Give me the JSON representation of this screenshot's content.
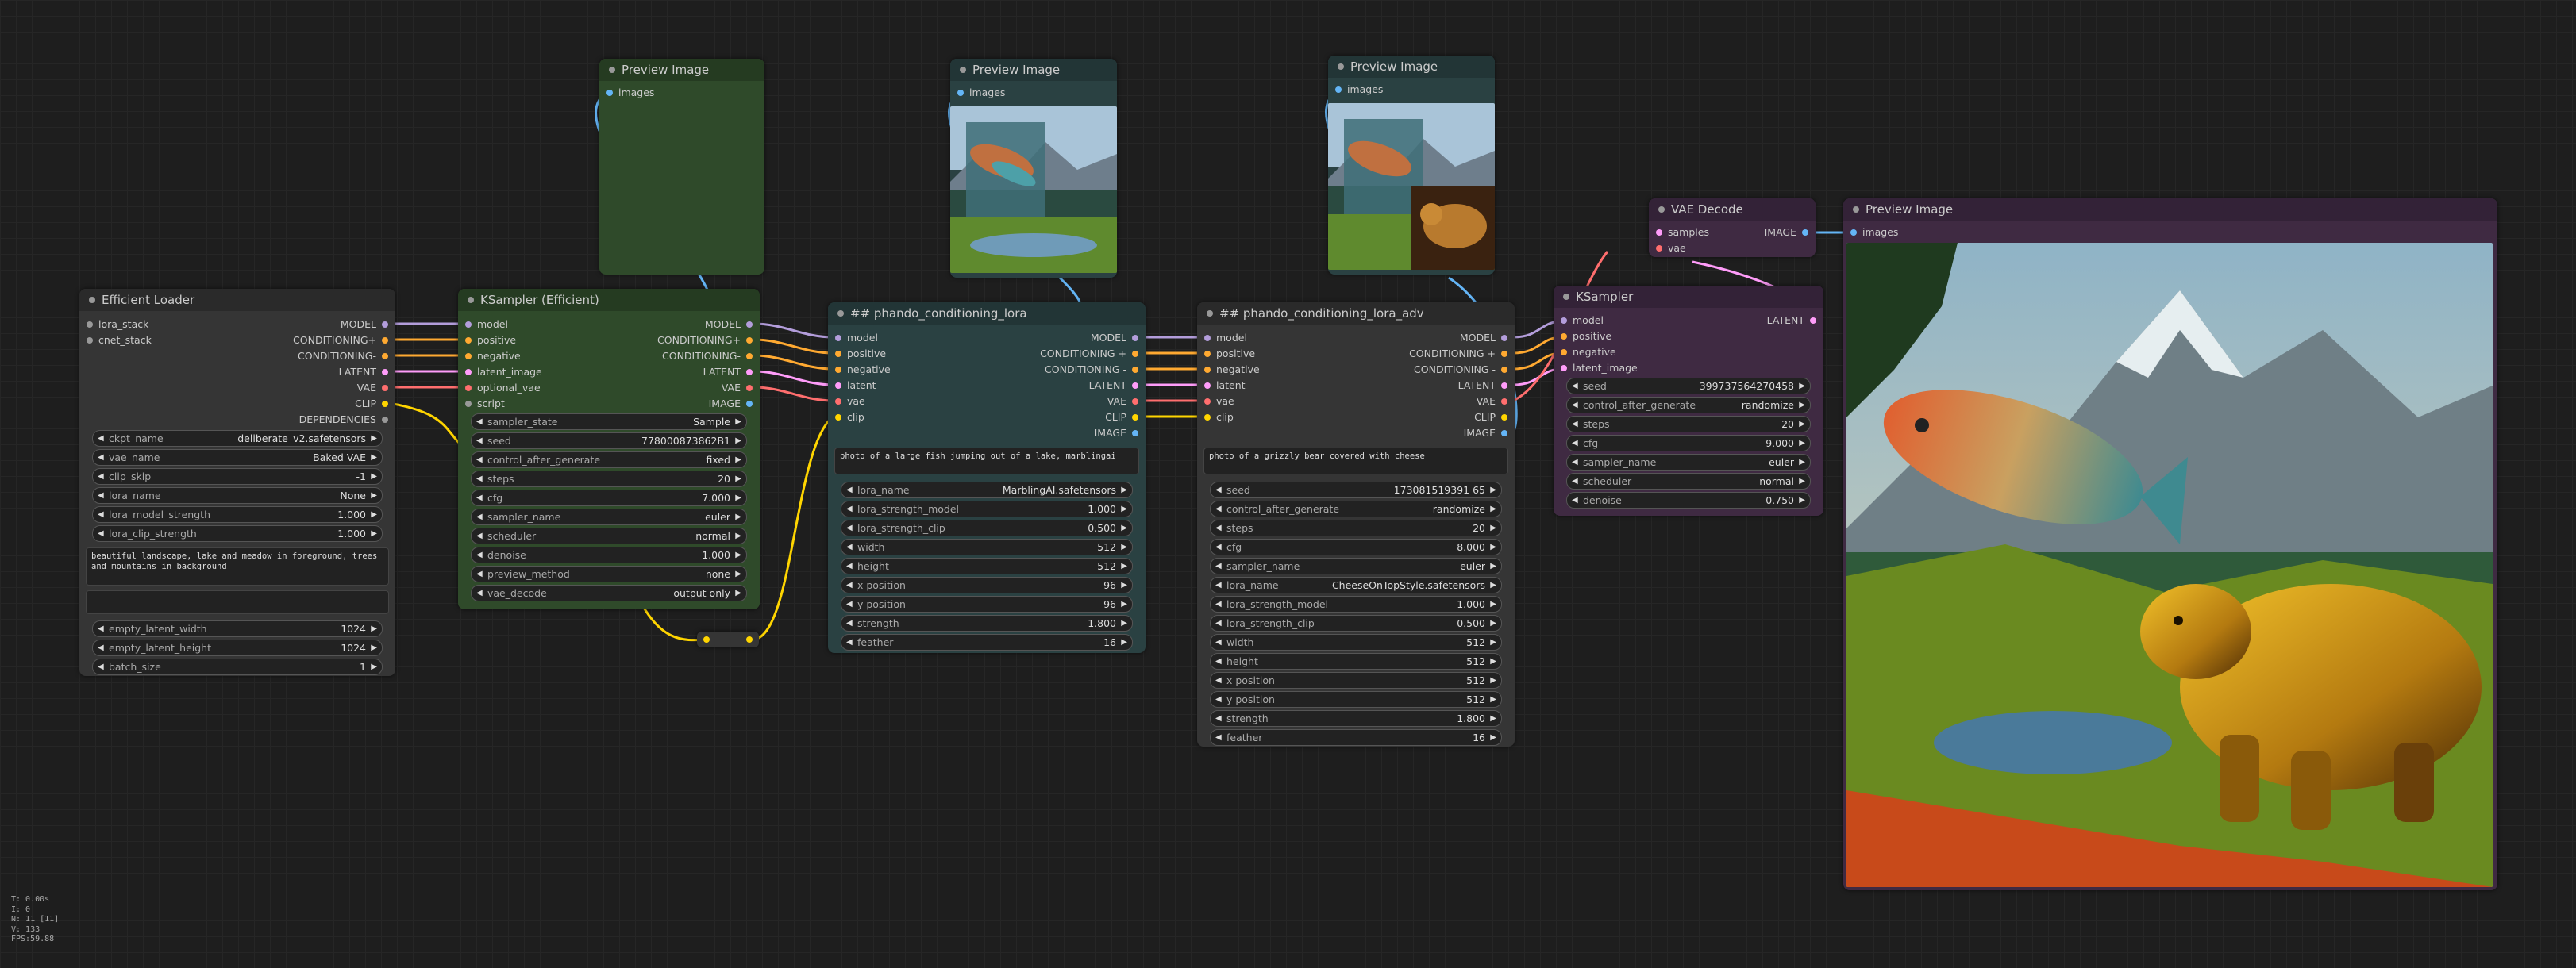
{
  "colors": {
    "background": "#1e1e1e",
    "node_body": "#353535",
    "node_title": "#2a2a2a",
    "green_body": "#2f4a2a",
    "green_title": "#253b21",
    "teal_body": "#2a4142",
    "teal_title": "#223536",
    "purple_body": "#3f2a42",
    "purple_title": "#332237",
    "model": "#b39ddb",
    "conditioning": "#ffa931",
    "latent": "#ff9cf9",
    "vae": "#ff6e6e",
    "clip": "#ffd500",
    "image": "#64b5f6",
    "generic": "#999999"
  },
  "efficient_loader": {
    "title": "Efficient Loader",
    "inputs": [
      "lora_stack",
      "cnet_stack"
    ],
    "outputs": [
      "MODEL",
      "CONDITIONING+",
      "CONDITIONING-",
      "LATENT",
      "VAE",
      "CLIP",
      "DEPENDENCIES"
    ],
    "widgets": [
      {
        "label": "ckpt_name",
        "value": "deliberate_v2.safetensors"
      },
      {
        "label": "vae_name",
        "value": "Baked VAE"
      },
      {
        "label": "clip_skip",
        "value": "-1"
      },
      {
        "label": "lora_name",
        "value": "None"
      },
      {
        "label": "lora_model_strength",
        "value": "1.000"
      },
      {
        "label": "lora_clip_strength",
        "value": "1.000"
      }
    ],
    "positive_prompt": "beautiful landscape, lake and meadow in foreground, trees and mountains in background",
    "negative_prompt": "",
    "widgets2": [
      {
        "label": "empty_latent_width",
        "value": "1024"
      },
      {
        "label": "empty_latent_height",
        "value": "1024"
      },
      {
        "label": "batch_size",
        "value": "1"
      }
    ]
  },
  "ksampler_efficient": {
    "title": "KSampler (Efficient)",
    "inputs": [
      "model",
      "positive",
      "negative",
      "latent_image",
      "optional_vae",
      "script"
    ],
    "outputs": [
      "MODEL",
      "CONDITIONING+",
      "CONDITIONING-",
      "LATENT",
      "VAE",
      "IMAGE"
    ],
    "widgets": [
      {
        "label": "sampler_state",
        "value": "Sample"
      },
      {
        "label": "seed",
        "value": "778000873862B1"
      },
      {
        "label": "control_after_generate",
        "value": "fixed"
      },
      {
        "label": "steps",
        "value": "20"
      },
      {
        "label": "cfg",
        "value": "7.000"
      },
      {
        "label": "sampler_name",
        "value": "euler"
      },
      {
        "label": "scheduler",
        "value": "normal"
      },
      {
        "label": "denoise",
        "value": "1.000"
      },
      {
        "label": "preview_method",
        "value": "none"
      },
      {
        "label": "vae_decode",
        "value": "output only"
      }
    ]
  },
  "lora1": {
    "title": "## phando_conditioning_lora",
    "inputs": [
      "model",
      "positive",
      "negative",
      "latent",
      "vae",
      "clip"
    ],
    "outputs": [
      "MODEL",
      "CONDITIONING +",
      "CONDITIONING -",
      "LATENT",
      "VAE",
      "CLIP",
      "IMAGE"
    ],
    "prompt": "photo of a large fish jumping out of a lake, marblingai",
    "widgets": [
      {
        "label": "lora_name",
        "value": "MarblingAI.safetensors"
      },
      {
        "label": "lora_strength_model",
        "value": "1.000"
      },
      {
        "label": "lora_strength_clip",
        "value": "0.500"
      },
      {
        "label": "width",
        "value": "512"
      },
      {
        "label": "height",
        "value": "512"
      },
      {
        "label": "x position",
        "value": "96"
      },
      {
        "label": "y position",
        "value": "96"
      },
      {
        "label": "strength",
        "value": "1.800"
      },
      {
        "label": "feather",
        "value": "16"
      }
    ]
  },
  "lora2": {
    "title": "## phando_conditioning_lora_adv",
    "inputs": [
      "model",
      "positive",
      "negative",
      "latent",
      "vae",
      "clip"
    ],
    "outputs": [
      "MODEL",
      "CONDITIONING +",
      "CONDITIONING -",
      "LATENT",
      "VAE",
      "CLIP",
      "IMAGE"
    ],
    "prompt": "photo of a grizzly bear covered with cheese",
    "widgets": [
      {
        "label": "seed",
        "value": "173081519391 65"
      },
      {
        "label": "control_after_generate",
        "value": "randomize"
      },
      {
        "label": "steps",
        "value": "20"
      },
      {
        "label": "cfg",
        "value": "8.000"
      },
      {
        "label": "sampler_name",
        "value": "euler"
      },
      {
        "label": "lora_name",
        "value": "CheeseOnTopStyle.safetensors"
      },
      {
        "label": "lora_strength_model",
        "value": "1.000"
      },
      {
        "label": "lora_strength_clip",
        "value": "0.500"
      },
      {
        "label": "width",
        "value": "512"
      },
      {
        "label": "height",
        "value": "512"
      },
      {
        "label": "x position",
        "value": "512"
      },
      {
        "label": "y position",
        "value": "512"
      },
      {
        "label": "strength",
        "value": "1.800"
      },
      {
        "label": "feather",
        "value": "16"
      }
    ]
  },
  "ksampler": {
    "title": "KSampler",
    "inputs": [
      "model",
      "positive",
      "negative",
      "latent_image"
    ],
    "outputs": [
      "LATENT"
    ],
    "widgets": [
      {
        "label": "seed",
        "value": "399737564270458"
      },
      {
        "label": "control_after_generate",
        "value": "randomize"
      },
      {
        "label": "steps",
        "value": "20"
      },
      {
        "label": "cfg",
        "value": "9.000"
      },
      {
        "label": "sampler_name",
        "value": "euler"
      },
      {
        "label": "scheduler",
        "value": "normal"
      },
      {
        "label": "denoise",
        "value": "0.750"
      }
    ]
  },
  "vae_decode": {
    "title": "VAE Decode",
    "inputs": [
      "samples",
      "vae"
    ],
    "outputs": [
      "IMAGE"
    ]
  },
  "preview1": {
    "title": "Preview Image",
    "input": "images"
  },
  "preview2": {
    "title": "Preview Image",
    "input": "images"
  },
  "preview3": {
    "title": "Preview Image",
    "input": "images"
  },
  "preview4": {
    "title": "Preview Image",
    "input": "images"
  },
  "stats": [
    "T: 0.00s",
    "I: 0",
    "N: 11 [11]",
    "V: 133",
    "FPS:59.88"
  ]
}
